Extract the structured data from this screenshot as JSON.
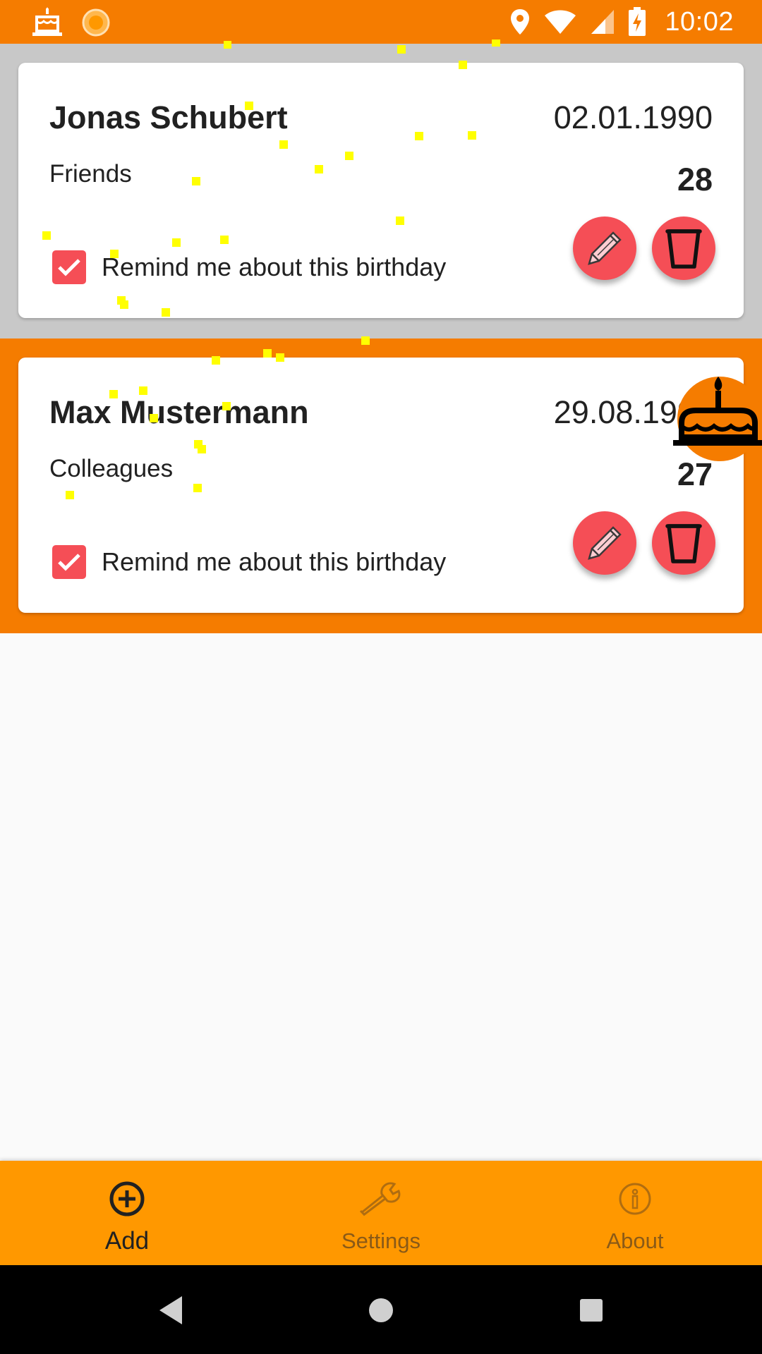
{
  "colors": {
    "status_bar": "#f57c00",
    "row_default": "#c8c8c8",
    "row_today": "#f57c00",
    "accent_red": "#f54e56",
    "nav_bar": "#ff9800",
    "nav_active": "#212121",
    "nav_inactive": "#8a5a17",
    "confetti": "#ffff00"
  },
  "status_bar": {
    "time": "10:02",
    "left_icons": [
      "cake-notification-icon",
      "orange-circle-notification-icon"
    ],
    "right_icons": [
      "location-icon",
      "wifi-icon",
      "signal-icon",
      "battery-charging-icon"
    ]
  },
  "birthdays": [
    {
      "name": "Jonas Schubert",
      "date": "02.01.1990",
      "group": "Friends",
      "age": "28",
      "remind_label": "Remind me about this birthday",
      "remind_checked": true,
      "is_today": false
    },
    {
      "name": "Max Mustermann",
      "date": "29.08.1990",
      "group": "Colleagues",
      "age": "27",
      "remind_label": "Remind me about this birthday",
      "remind_checked": true,
      "is_today": true
    }
  ],
  "row_icons": {
    "edit": "pencil-icon",
    "delete": "trash-icon",
    "today_badge": "birthday-cake-icon"
  },
  "bottom_nav": {
    "items": [
      {
        "label": "Add",
        "icon": "add-circle-icon",
        "active": true
      },
      {
        "label": "Settings",
        "icon": "wrench-icon",
        "active": false
      },
      {
        "label": "About",
        "icon": "info-icon",
        "active": false
      }
    ]
  },
  "system_nav": {
    "buttons": [
      "back-icon",
      "home-icon",
      "recents-icon"
    ]
  }
}
